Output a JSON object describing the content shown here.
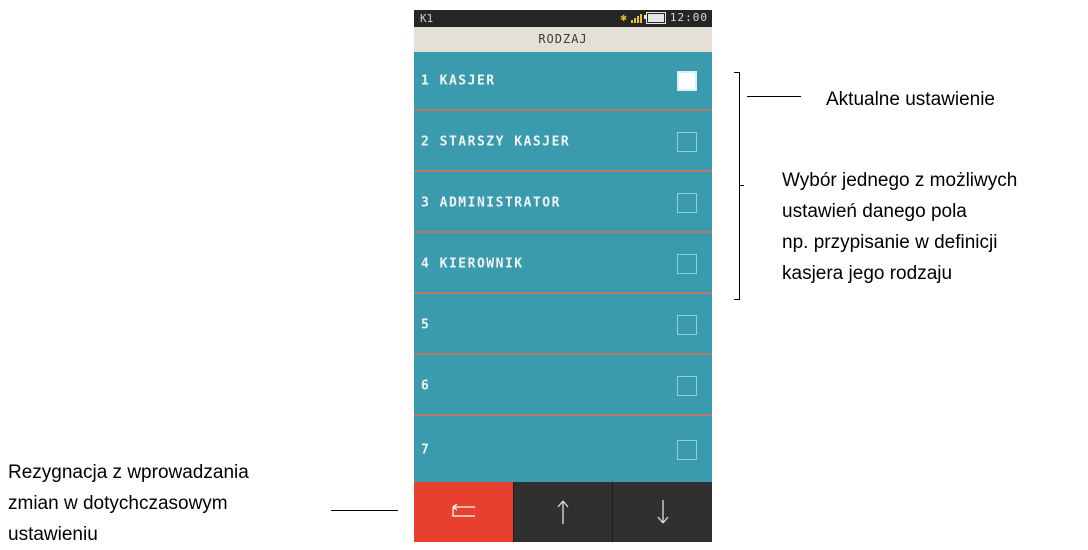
{
  "statusbar": {
    "left": "K1",
    "time": "12:00",
    "icons": [
      "bluetooth-icon",
      "signal-icon",
      "battery-icon"
    ]
  },
  "title": "RODZAJ",
  "items": [
    {
      "label": "1 KASJER",
      "checked": true
    },
    {
      "label": "2 STARSZY KASJER",
      "checked": false
    },
    {
      "label": "3 ADMINISTRATOR",
      "checked": false
    },
    {
      "label": "4 KIEROWNIK",
      "checked": false
    },
    {
      "label": "5",
      "checked": false
    },
    {
      "label": "6",
      "checked": false
    },
    {
      "label": "7",
      "checked": false
    }
  ],
  "buttons": {
    "back_icon": "back-arrow-icon",
    "up_icon": "arrow-up-icon",
    "down_icon": "arrow-down-icon"
  },
  "annotations": {
    "current_setting": "Aktualne ustawienie",
    "choice_line1": "Wybór jednego z możliwych",
    "choice_line2": "ustawień danego pola",
    "choice_line3": "np. przypisanie w definicji",
    "choice_line4": "kasjera jego rodzaju",
    "cancel_line1": "Rezygnacja z wprowadzania",
    "cancel_line2": "zmian w dotychczasowym",
    "cancel_line3": "ustawieniu"
  },
  "colors": {
    "list_bg": "#3a9bae",
    "separator": "#b77a6a",
    "back_button": "#e8402f",
    "nav_button": "#303030",
    "title_bg": "#e4e0d8"
  }
}
